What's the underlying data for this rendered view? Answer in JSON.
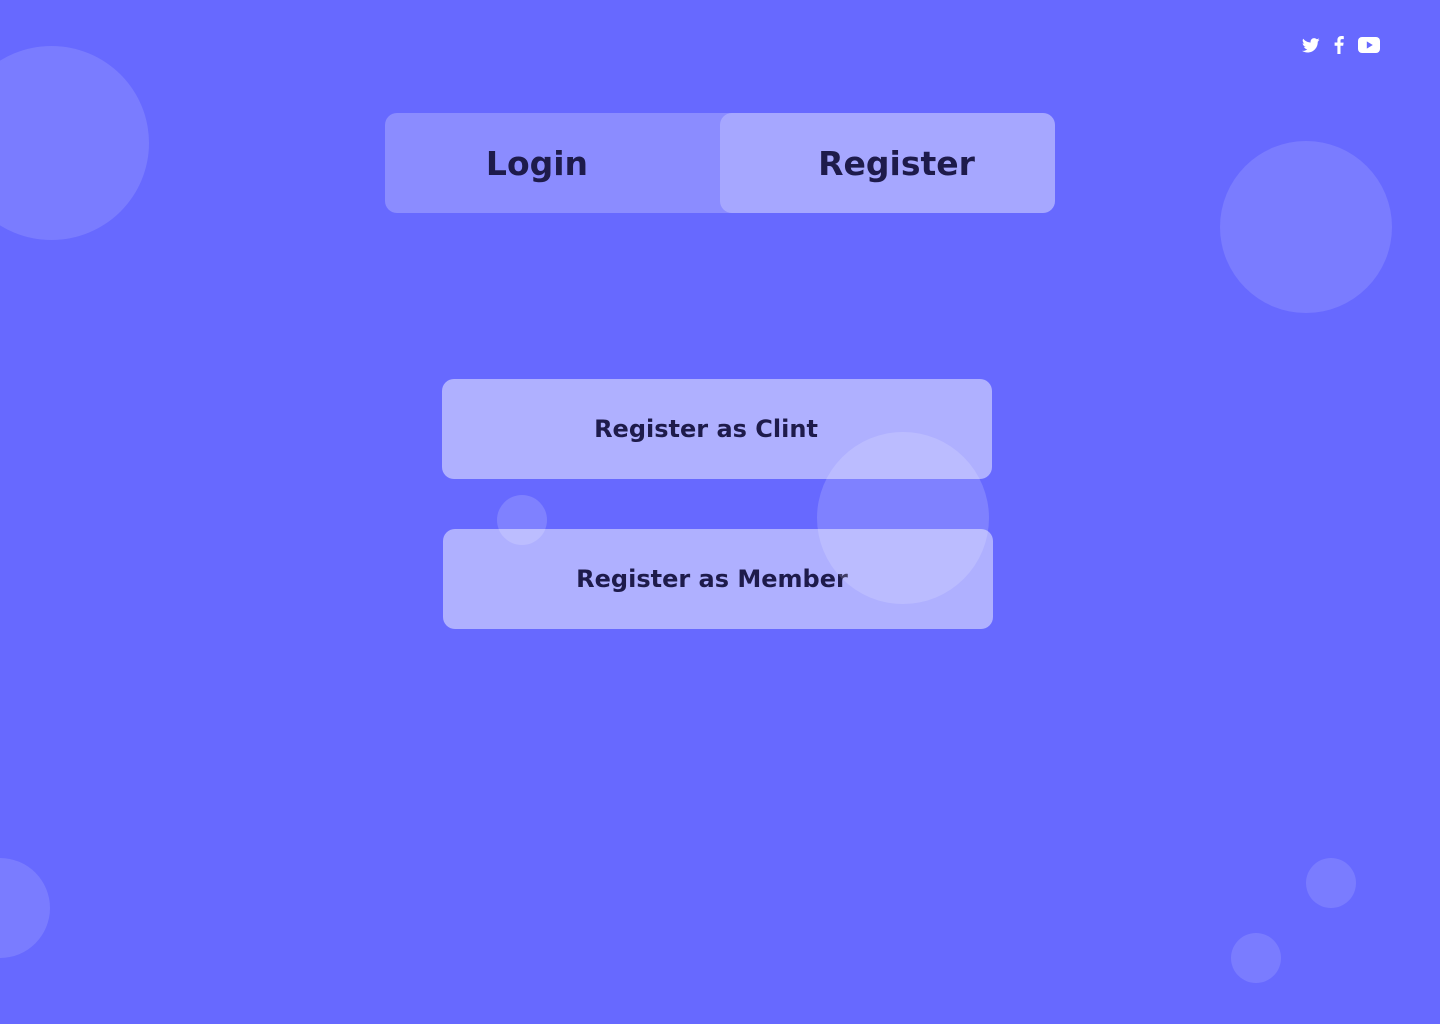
{
  "theme": {
    "background": "#6769ff",
    "text": "#1e1b4b",
    "icon": "#ffffff"
  },
  "social": {
    "icons": [
      "twitter-icon",
      "facebook-icon",
      "youtube-icon"
    ]
  },
  "tabs": {
    "login": "Login",
    "register": "Register",
    "active": "register"
  },
  "register_options": {
    "client": "Register as Clint",
    "member": "Register as Member"
  }
}
